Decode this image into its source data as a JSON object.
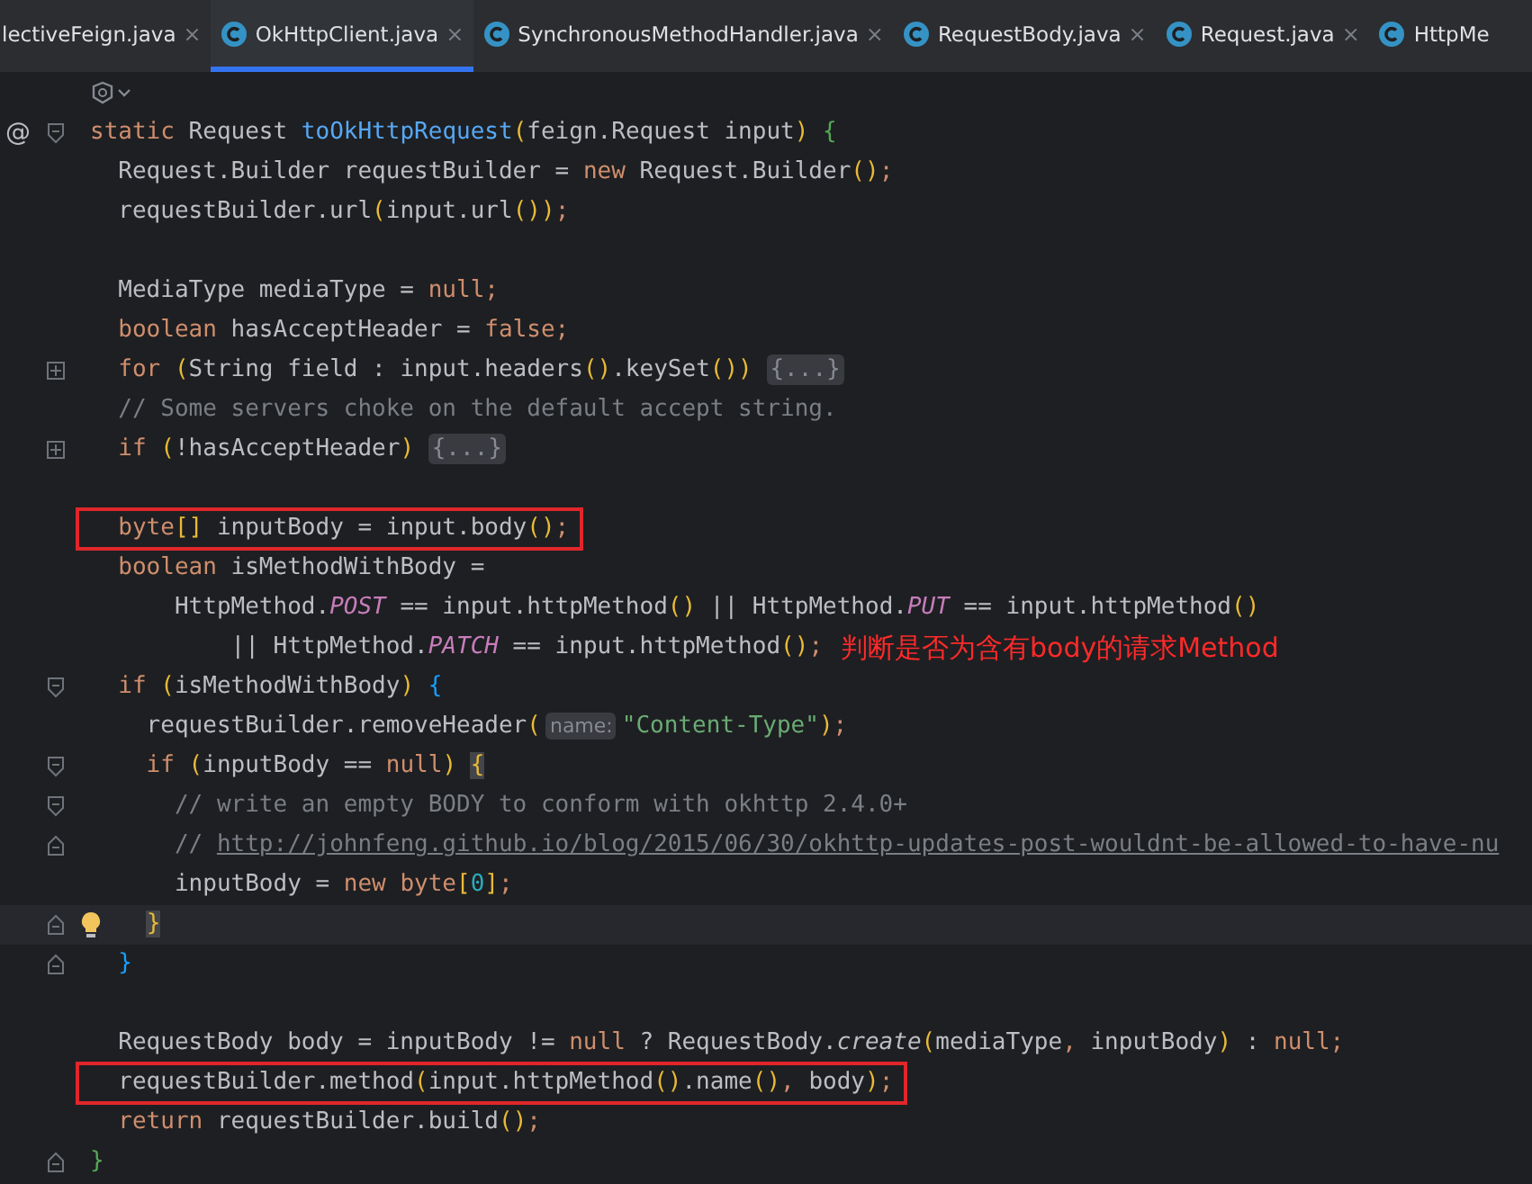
{
  "tabs": [
    {
      "label": "lectiveFeign.java",
      "selected": false,
      "close": "×"
    },
    {
      "label": "OkHttpClient.java",
      "selected": true,
      "close": "×"
    },
    {
      "label": "SynchronousMethodHandler.java",
      "selected": false,
      "close": "×"
    },
    {
      "label": "RequestBody.java",
      "selected": false,
      "close": "×"
    },
    {
      "label": "Request.java",
      "selected": false,
      "close": "×"
    },
    {
      "label": "HttpMe",
      "selected": false
    }
  ],
  "lines": [
    {
      "marker": "@",
      "folded": false,
      "fold_end": false,
      "tokens": [
        {
          "kind": "kw",
          "text": "static "
        },
        {
          "kind": "plain",
          "text": "Request "
        },
        {
          "kind": "decl",
          "text": "toOkHttpRequest"
        },
        {
          "kind": "paren",
          "text": "("
        },
        {
          "kind": "plain",
          "text": "feign.Request input"
        },
        {
          "kind": "paren",
          "text": ") "
        },
        {
          "kind": "brace_green",
          "text": "{"
        }
      ]
    },
    {
      "tokens": [
        {
          "kind": "plain",
          "text": "  Request.Builder requestBuilder = "
        },
        {
          "kind": "kw",
          "text": "new "
        },
        {
          "kind": "plain",
          "text": "Request.Builder"
        },
        {
          "kind": "paren",
          "text": "()"
        },
        {
          "kind": "kw",
          "text": ";"
        }
      ]
    },
    {
      "tokens": [
        {
          "kind": "plain",
          "text": "  requestBuilder.url"
        },
        {
          "kind": "paren",
          "text": "("
        },
        {
          "kind": "plain",
          "text": "input.url"
        },
        {
          "kind": "paren",
          "text": "())"
        },
        {
          "kind": "kw",
          "text": ";"
        }
      ]
    },
    {
      "gap_before": true,
      "tokens": [
        {
          "kind": "plain",
          "text": "  MediaType mediaType = "
        },
        {
          "kind": "kw",
          "text": "null;"
        }
      ]
    },
    {
      "tokens": [
        {
          "kind": "kw",
          "text": "  boolean "
        },
        {
          "kind": "plain",
          "text": "hasAcceptHeader = "
        },
        {
          "kind": "kw",
          "text": "false;"
        }
      ]
    },
    {
      "folded": true,
      "tokens": [
        {
          "kind": "kw",
          "text": "  for "
        },
        {
          "kind": "paren",
          "text": "("
        },
        {
          "kind": "plain",
          "text": "String field : input.headers"
        },
        {
          "kind": "paren",
          "text": "()"
        },
        {
          "kind": "plain",
          "text": ".keySet"
        },
        {
          "kind": "paren",
          "text": "()) "
        },
        {
          "kind": "chip",
          "text": "{...}"
        }
      ]
    },
    {
      "tokens": [
        {
          "kind": "comment",
          "text": "  // Some servers choke on the default accept string."
        }
      ]
    },
    {
      "folded": true,
      "tokens": [
        {
          "kind": "kw",
          "text": "  if "
        },
        {
          "kind": "paren",
          "text": "("
        },
        {
          "kind": "plain",
          "text": "!hasAcceptHeader"
        },
        {
          "kind": "paren",
          "text": ") "
        },
        {
          "kind": "chip",
          "text": "{...}"
        }
      ]
    },
    {
      "gap_before": true,
      "boxed": true,
      "tokens": [
        {
          "kind": "kw",
          "text": "  byte"
        },
        {
          "kind": "paren",
          "text": "[]"
        },
        {
          "kind": "plain",
          "text": " inputBody = input.body"
        },
        {
          "kind": "paren",
          "text": "()"
        },
        {
          "kind": "kw",
          "text": ";"
        }
      ]
    },
    {
      "tokens": [
        {
          "kind": "kw",
          "text": "  boolean "
        },
        {
          "kind": "plain",
          "text": "isMethodWithBody ="
        }
      ]
    },
    {
      "tokens": [
        {
          "kind": "plain",
          "text": "      HttpMethod."
        },
        {
          "kind": "static",
          "text": "POST"
        },
        {
          "kind": "plain",
          "text": " == input.httpMethod"
        },
        {
          "kind": "paren",
          "text": "()"
        },
        {
          "kind": "plain",
          "text": " || HttpMethod."
        },
        {
          "kind": "static",
          "text": "PUT"
        },
        {
          "kind": "plain",
          "text": " == input.httpMethod"
        },
        {
          "kind": "paren",
          "text": "()"
        }
      ]
    },
    {
      "note": "判断是否为含有body的请求Method",
      "tokens": [
        {
          "kind": "plain",
          "text": "          || HttpMethod."
        },
        {
          "kind": "static",
          "text": "PATCH"
        },
        {
          "kind": "plain",
          "text": " == input.httpMethod"
        },
        {
          "kind": "paren",
          "text": "()"
        },
        {
          "kind": "kw",
          "text": ";"
        }
      ]
    },
    {
      "folded": false,
      "fold_end": false,
      "tokens": [
        {
          "kind": "kw",
          "text": "  if "
        },
        {
          "kind": "paren",
          "text": "("
        },
        {
          "kind": "plain",
          "text": "isMethodWithBody"
        },
        {
          "kind": "paren",
          "text": ") "
        },
        {
          "kind": "brace_blue",
          "text": "{"
        }
      ]
    },
    {
      "tokens": [
        {
          "kind": "plain",
          "text": "    requestBuilder.removeHeader"
        },
        {
          "kind": "paren",
          "text": "("
        },
        {
          "kind": "hint",
          "text": "name:"
        },
        {
          "kind": "str",
          "text": "\"Content-Type\""
        },
        {
          "kind": "paren",
          "text": ")"
        },
        {
          "kind": "kw",
          "text": ";"
        }
      ]
    },
    {
      "folded": false,
      "fold_end": false,
      "tokens": [
        {
          "kind": "kw",
          "text": "    if "
        },
        {
          "kind": "paren",
          "text": "("
        },
        {
          "kind": "plain",
          "text": "inputBody == "
        },
        {
          "kind": "kw",
          "text": "null"
        },
        {
          "kind": "paren",
          "text": ") "
        },
        {
          "kind": "brace_match",
          "text": "{"
        }
      ]
    },
    {
      "folded": false,
      "fold_end": false,
      "tokens": [
        {
          "kind": "comment",
          "text": "      // write an empty BODY to conform with okhttp 2.4.0+"
        }
      ]
    },
    {
      "folded": false,
      "fold_end": true,
      "tokens": [
        {
          "kind": "comment",
          "text": "      // "
        },
        {
          "kind": "link",
          "text": "http://johnfeng.github.io/blog/2015/06/30/okhttp-updates-post-wouldnt-be-allowed-to-have-nu"
        }
      ]
    },
    {
      "tokens": [
        {
          "kind": "plain",
          "text": "      inputBody = "
        },
        {
          "kind": "kw",
          "text": "new byte"
        },
        {
          "kind": "paren",
          "text": "["
        },
        {
          "kind": "num",
          "text": "0"
        },
        {
          "kind": "paren",
          "text": "]"
        },
        {
          "kind": "kw",
          "text": ";"
        }
      ]
    },
    {
      "folded": false,
      "fold_end": true,
      "current": true,
      "bulb": true,
      "tokens": [
        {
          "kind": "brace_match",
          "text": "    }"
        }
      ]
    },
    {
      "folded": false,
      "fold_end": true,
      "tokens": [
        {
          "kind": "brace_blue",
          "text": "  }"
        }
      ]
    },
    {
      "gap_before": true,
      "tokens": [
        {
          "kind": "plain",
          "text": "  RequestBody body = inputBody != "
        },
        {
          "kind": "kw",
          "text": "null"
        },
        {
          "kind": "plain",
          "text": " ? RequestBody."
        },
        {
          "kind": "italic",
          "text": "create"
        },
        {
          "kind": "paren",
          "text": "("
        },
        {
          "kind": "plain",
          "text": "mediaType"
        },
        {
          "kind": "kw",
          "text": ", "
        },
        {
          "kind": "plain",
          "text": "inputBody"
        },
        {
          "kind": "paren",
          "text": ")"
        },
        {
          "kind": "plain",
          "text": " : "
        },
        {
          "kind": "kw",
          "text": "null;"
        }
      ]
    },
    {
      "boxed": true,
      "tokens": [
        {
          "kind": "plain",
          "text": "  requestBuilder.method"
        },
        {
          "kind": "paren",
          "text": "("
        },
        {
          "kind": "plain",
          "text": "input.httpMethod"
        },
        {
          "kind": "paren",
          "text": "()"
        },
        {
          "kind": "plain",
          "text": ".name"
        },
        {
          "kind": "paren",
          "text": "()"
        },
        {
          "kind": "kw",
          "text": ", "
        },
        {
          "kind": "plain",
          "text": "body"
        },
        {
          "kind": "paren",
          "text": ")"
        },
        {
          "kind": "kw",
          "text": ";"
        }
      ]
    },
    {
      "tokens": [
        {
          "kind": "kw",
          "text": "  return "
        },
        {
          "kind": "plain",
          "text": "requestBuilder.build"
        },
        {
          "kind": "paren",
          "text": "()"
        },
        {
          "kind": "kw",
          "text": ";"
        }
      ]
    },
    {
      "folded": false,
      "fold_end": true,
      "tokens": [
        {
          "kind": "brace_green",
          "text": "}"
        }
      ]
    }
  ]
}
